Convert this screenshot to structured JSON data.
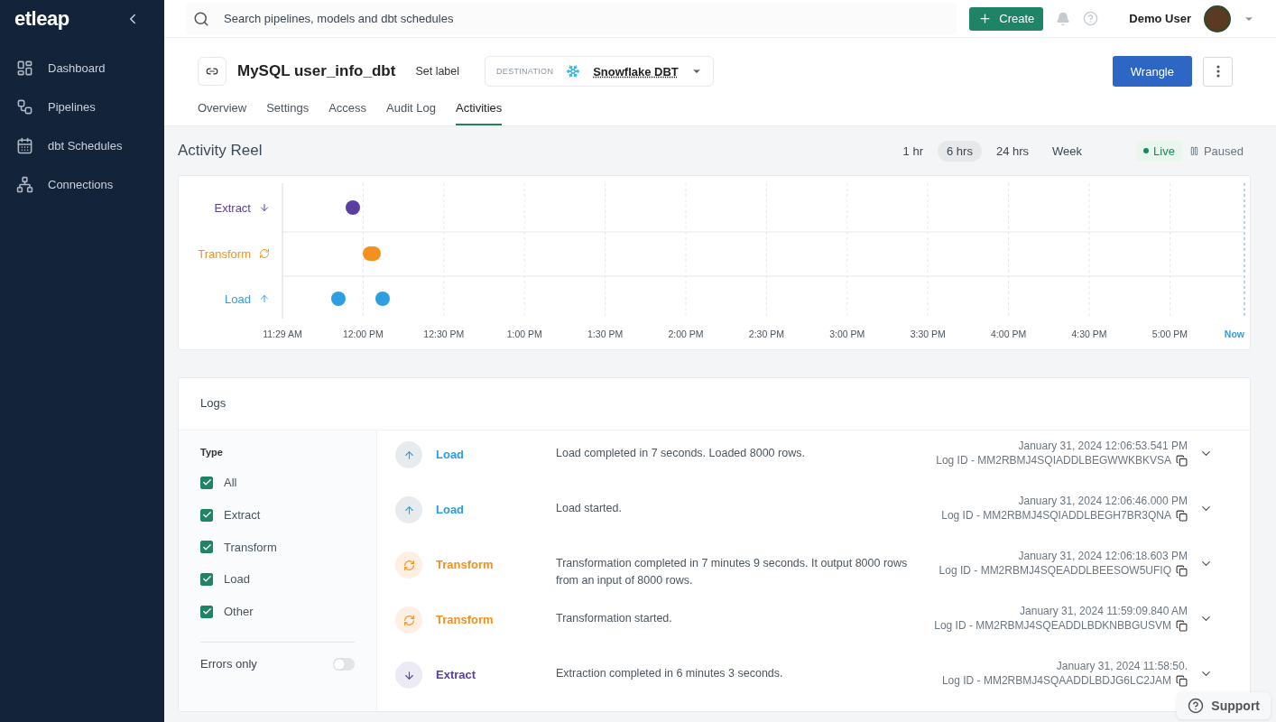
{
  "sidebar": {
    "logo": "etleap",
    "items": [
      {
        "label": "Dashboard",
        "kind": "dashboard"
      },
      {
        "label": "Pipelines",
        "kind": "pipelines"
      },
      {
        "label": "dbt Schedules",
        "kind": "schedules"
      },
      {
        "label": "Connections",
        "kind": "connections"
      }
    ]
  },
  "topbar": {
    "search": {
      "placeholder": "Search pipelines, models and dbt schedules"
    },
    "create_button": "Create",
    "user": "Demo User"
  },
  "pipeline": {
    "title": "MySQL user_info_dbt",
    "set_label": "Set label",
    "destination": {
      "label": "DESTINATION",
      "value": "Snowflake DBT"
    },
    "wrangle_button": "Wrangle",
    "tabs": [
      {
        "label": "Overview",
        "selected": false
      },
      {
        "label": "Settings",
        "selected": false
      },
      {
        "label": "Access",
        "selected": false
      },
      {
        "label": "Audit Log",
        "selected": false
      },
      {
        "label": "Activities",
        "selected": true
      }
    ]
  },
  "activity_reel": {
    "title": "Activity Reel",
    "ranges": [
      {
        "label": "1 hr",
        "selected": false
      },
      {
        "label": "6 hrs",
        "selected": true
      },
      {
        "label": "24 hrs",
        "selected": false
      },
      {
        "label": "Week",
        "selected": false
      }
    ],
    "modes": [
      {
        "label": "Live",
        "kind": "live",
        "selected": true
      },
      {
        "label": "Paused",
        "kind": "paused",
        "selected": false
      }
    ],
    "timeline": {
      "rows": [
        {
          "label": "Extract",
          "kind": "extract"
        },
        {
          "label": "Transform",
          "kind": "transform"
        },
        {
          "label": "Load",
          "kind": "load"
        }
      ],
      "axis_labels": [
        "11:29 AM",
        "12:00 PM",
        "12:30 PM",
        "1:00 PM",
        "1:30 PM",
        "2:00 PM",
        "2:30 PM",
        "3:00 PM",
        "3:30 PM",
        "4:00 PM",
        "4:30 PM",
        "5:00 PM"
      ],
      "now_label": "Now"
    }
  },
  "logs": {
    "title": "Logs",
    "filter": {
      "title": "Type",
      "options": [
        {
          "label": "All",
          "checked": true
        },
        {
          "label": "Extract",
          "checked": true
        },
        {
          "label": "Transform",
          "checked": true
        },
        {
          "label": "Load",
          "checked": true
        },
        {
          "label": "Other",
          "checked": true
        }
      ]
    },
    "errors_only": {
      "label": "Errors only",
      "on": false
    },
    "entries": [
      {
        "kind": "load",
        "type": "Load",
        "message": "Load completed in 7 seconds. Loaded 8000 rows.",
        "time": "January 31, 2024 12:06:53.541 PM",
        "log_id": "Log ID - MM2RBMJ4SQIADDLBEGWWKBKVSA"
      },
      {
        "kind": "load",
        "type": "Load",
        "message": "Load started.",
        "time": "January 31, 2024 12:06:46.000 PM",
        "log_id": "Log ID - MM2RBMJ4SQIADDLBEGH7BR3QNA"
      },
      {
        "kind": "transform",
        "type": "Transform",
        "message": "Transformation completed in 7 minutes 9 seconds. It output 8000 rows from an input of 8000 rows.",
        "time": "January 31, 2024 12:06:18.603 PM",
        "log_id": "Log ID - MM2RBMJ4SQEADDLBEESOW5UFIQ"
      },
      {
        "kind": "transform",
        "type": "Transform",
        "message": "Transformation started.",
        "time": "January 31, 2024 11:59:09.840 AM",
        "log_id": "Log ID - MM2RBMJ4SQEADDLBDKNBBGUSVM"
      },
      {
        "kind": "extract",
        "type": "Extract",
        "message": "Extraction completed in 6 minutes 3 seconds.",
        "time": "January 31, 2024 11:58:50.",
        "log_id": "Log ID - MM2RBMJ4SQAADDLBDJG6LC2JAM"
      }
    ]
  },
  "support_button": "Support"
}
